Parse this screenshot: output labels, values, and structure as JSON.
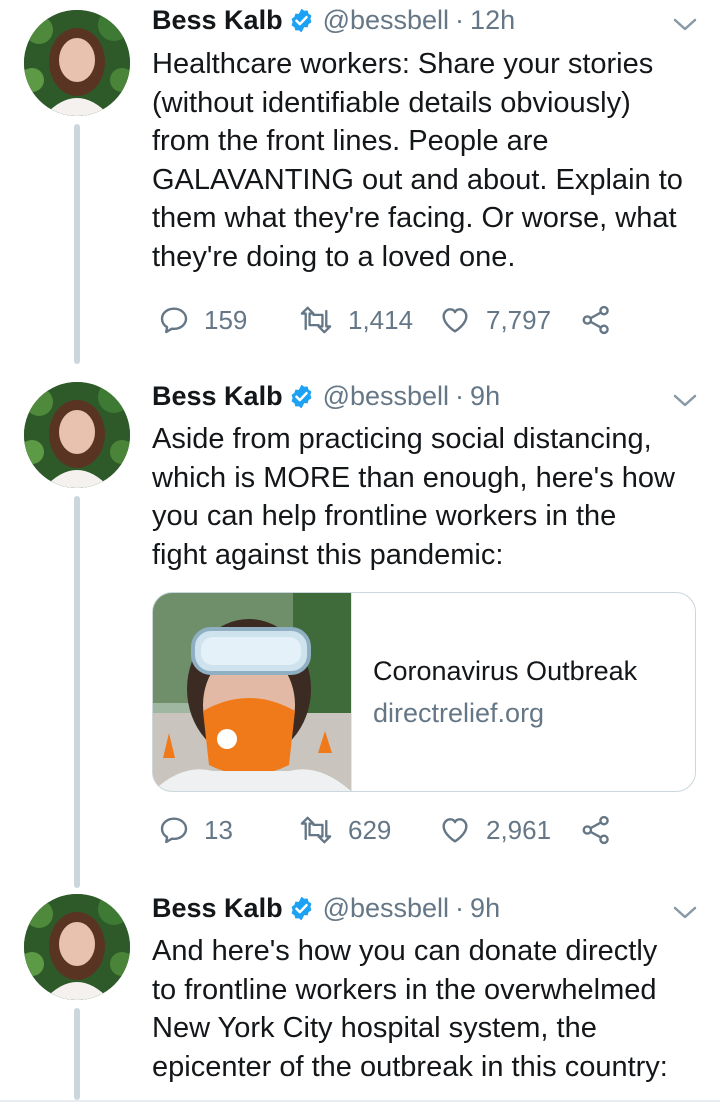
{
  "colors": {
    "text": "#14171a",
    "secondary": "#657786",
    "verified": "#1da1f2",
    "thread_line": "#ccd6dd",
    "border": "#ccd6dd"
  },
  "tweets": [
    {
      "name": "Bess Kalb",
      "handle": "@bessbell",
      "separator": "·",
      "time": "12h",
      "text": [
        "Healthcare workers: Share your stories",
        "(without identifiable details obviously)",
        "from the front lines. People are",
        "GALAVANTING out and about. Explain to",
        "them what they're facing. Or worse, what",
        "they're doing to a loved one."
      ],
      "replies": "159",
      "retweets": "1,414",
      "likes": "7,797"
    },
    {
      "name": "Bess Kalb",
      "handle": "@bessbell",
      "separator": "·",
      "time": "9h",
      "text": [
        "Aside from practicing social distancing,",
        "which is MORE than enough, here's how",
        "you can help frontline workers in the",
        "fight against this pandemic:"
      ],
      "card": {
        "title": "Coronavirus Outbreak",
        "domain": "directrelief.org",
        "image": "person-in-goggles-and-orange-mask"
      },
      "replies": "13",
      "retweets": "629",
      "likes": "2,961"
    },
    {
      "name": "Bess Kalb",
      "handle": "@bessbell",
      "separator": "·",
      "time": "9h",
      "text": [
        "And here's how you can donate directly",
        "to frontline workers in the overwhelmed",
        "New York City hospital system, the",
        "epicenter of the outbreak in this country:"
      ]
    }
  ],
  "icons": {
    "verified": "verified-badge-icon",
    "caret": "chevron-down-icon",
    "reply": "reply-icon",
    "retweet": "retweet-icon",
    "like": "heart-icon",
    "share": "share-icon"
  }
}
